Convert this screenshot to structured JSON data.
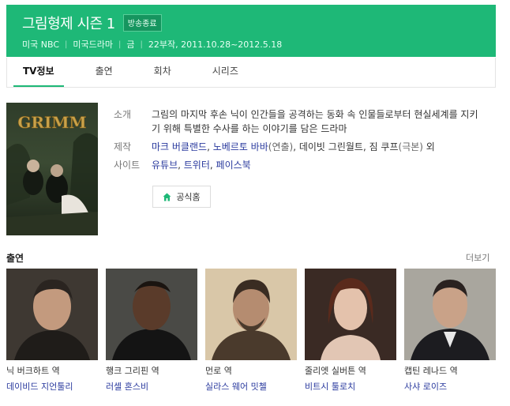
{
  "header": {
    "title": "그림형제 시즌 1",
    "badge": "방송종료",
    "meta": [
      "미국 NBC",
      "미국드라마",
      "금",
      "22부작, 2011.10.28~2012.5.18"
    ]
  },
  "tabs": [
    "TV정보",
    "출연",
    "회차",
    "시리즈"
  ],
  "poster": {
    "logo_text": "GRIMM"
  },
  "info": {
    "intro_label": "소개",
    "intro_text": "그림의 마지막 후손 닉이 인간들을 공격하는 동화 속 인물들로부터 현실세계를 지키기 위해 특별한 수사를 하는 이야기를 담은 드라마",
    "staff_label": "제작",
    "staff_link1": "마크 버클랜드",
    "staff_link2": "노베르토 바바",
    "staff_role2": "(연출)",
    "staff_rest": ", 데이빗 그린월트, 짐 쿠프",
    "staff_role_rest": "(극본)",
    "staff_suffix": " 외",
    "site_label": "사이트",
    "sites": [
      "유튜브",
      "트위터",
      "페이스북"
    ],
    "official_label": "공식홈"
  },
  "cast": {
    "heading": "출연",
    "more": "더보기",
    "members": [
      {
        "role": "닉 버크하트 역",
        "actor": "데이비드 지언툴리"
      },
      {
        "role": "행크 그리핀 역",
        "actor": "러셀 혼스비"
      },
      {
        "role": "먼로 역",
        "actor": "실라스 웨어 밋첼"
      },
      {
        "role": "줄리엣 실버튼 역",
        "actor": "비트시 툴로치"
      },
      {
        "role": "캡틴 레나드 역",
        "actor": "사샤 로이즈"
      }
    ]
  },
  "colors": {
    "brand": "#1eb877",
    "link": "#2a3a9e"
  }
}
